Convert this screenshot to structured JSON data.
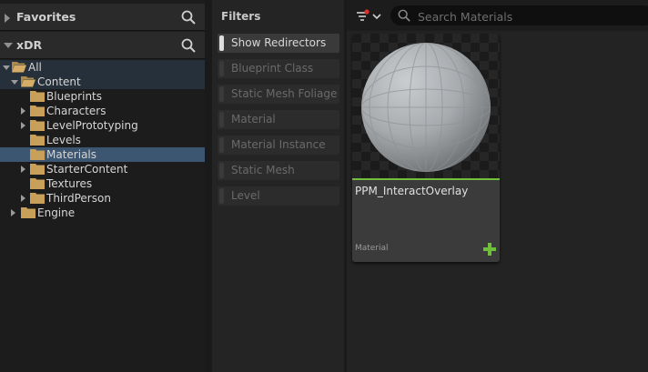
{
  "tree": {
    "favorites_label": "Favorites",
    "project_label": "xDR",
    "items": [
      {
        "label": "All"
      },
      {
        "label": "Content"
      },
      {
        "label": "Blueprints"
      },
      {
        "label": "Characters"
      },
      {
        "label": "LevelPrototyping"
      },
      {
        "label": "Levels"
      },
      {
        "label": "Materials"
      },
      {
        "label": "StarterContent"
      },
      {
        "label": "Textures"
      },
      {
        "label": "ThirdPerson"
      },
      {
        "label": "Engine"
      }
    ],
    "selected_item": "Materials"
  },
  "filters": {
    "title": "Filters",
    "items": [
      {
        "label": "Show Redirectors",
        "active": true
      },
      {
        "label": "Blueprint Class",
        "active": false
      },
      {
        "label": "Static Mesh Foliage",
        "active": false
      },
      {
        "label": "Material",
        "active": false
      },
      {
        "label": "Material Instance",
        "active": false
      },
      {
        "label": "Static Mesh",
        "active": false
      },
      {
        "label": "Level",
        "active": false
      }
    ]
  },
  "content": {
    "search_placeholder": "Search Materials",
    "asset": {
      "name": "PPM_InteractOverlay",
      "type": "Material",
      "type_color": "#6fbf3b"
    }
  },
  "icons": {
    "search": "search-icon",
    "filter": "filter-icon",
    "folder": "folder-icon",
    "add": "plus-icon"
  },
  "colors": {
    "accent_green": "#6fbf3b",
    "folder": "#c9a05a",
    "selection": "#3c5570"
  }
}
